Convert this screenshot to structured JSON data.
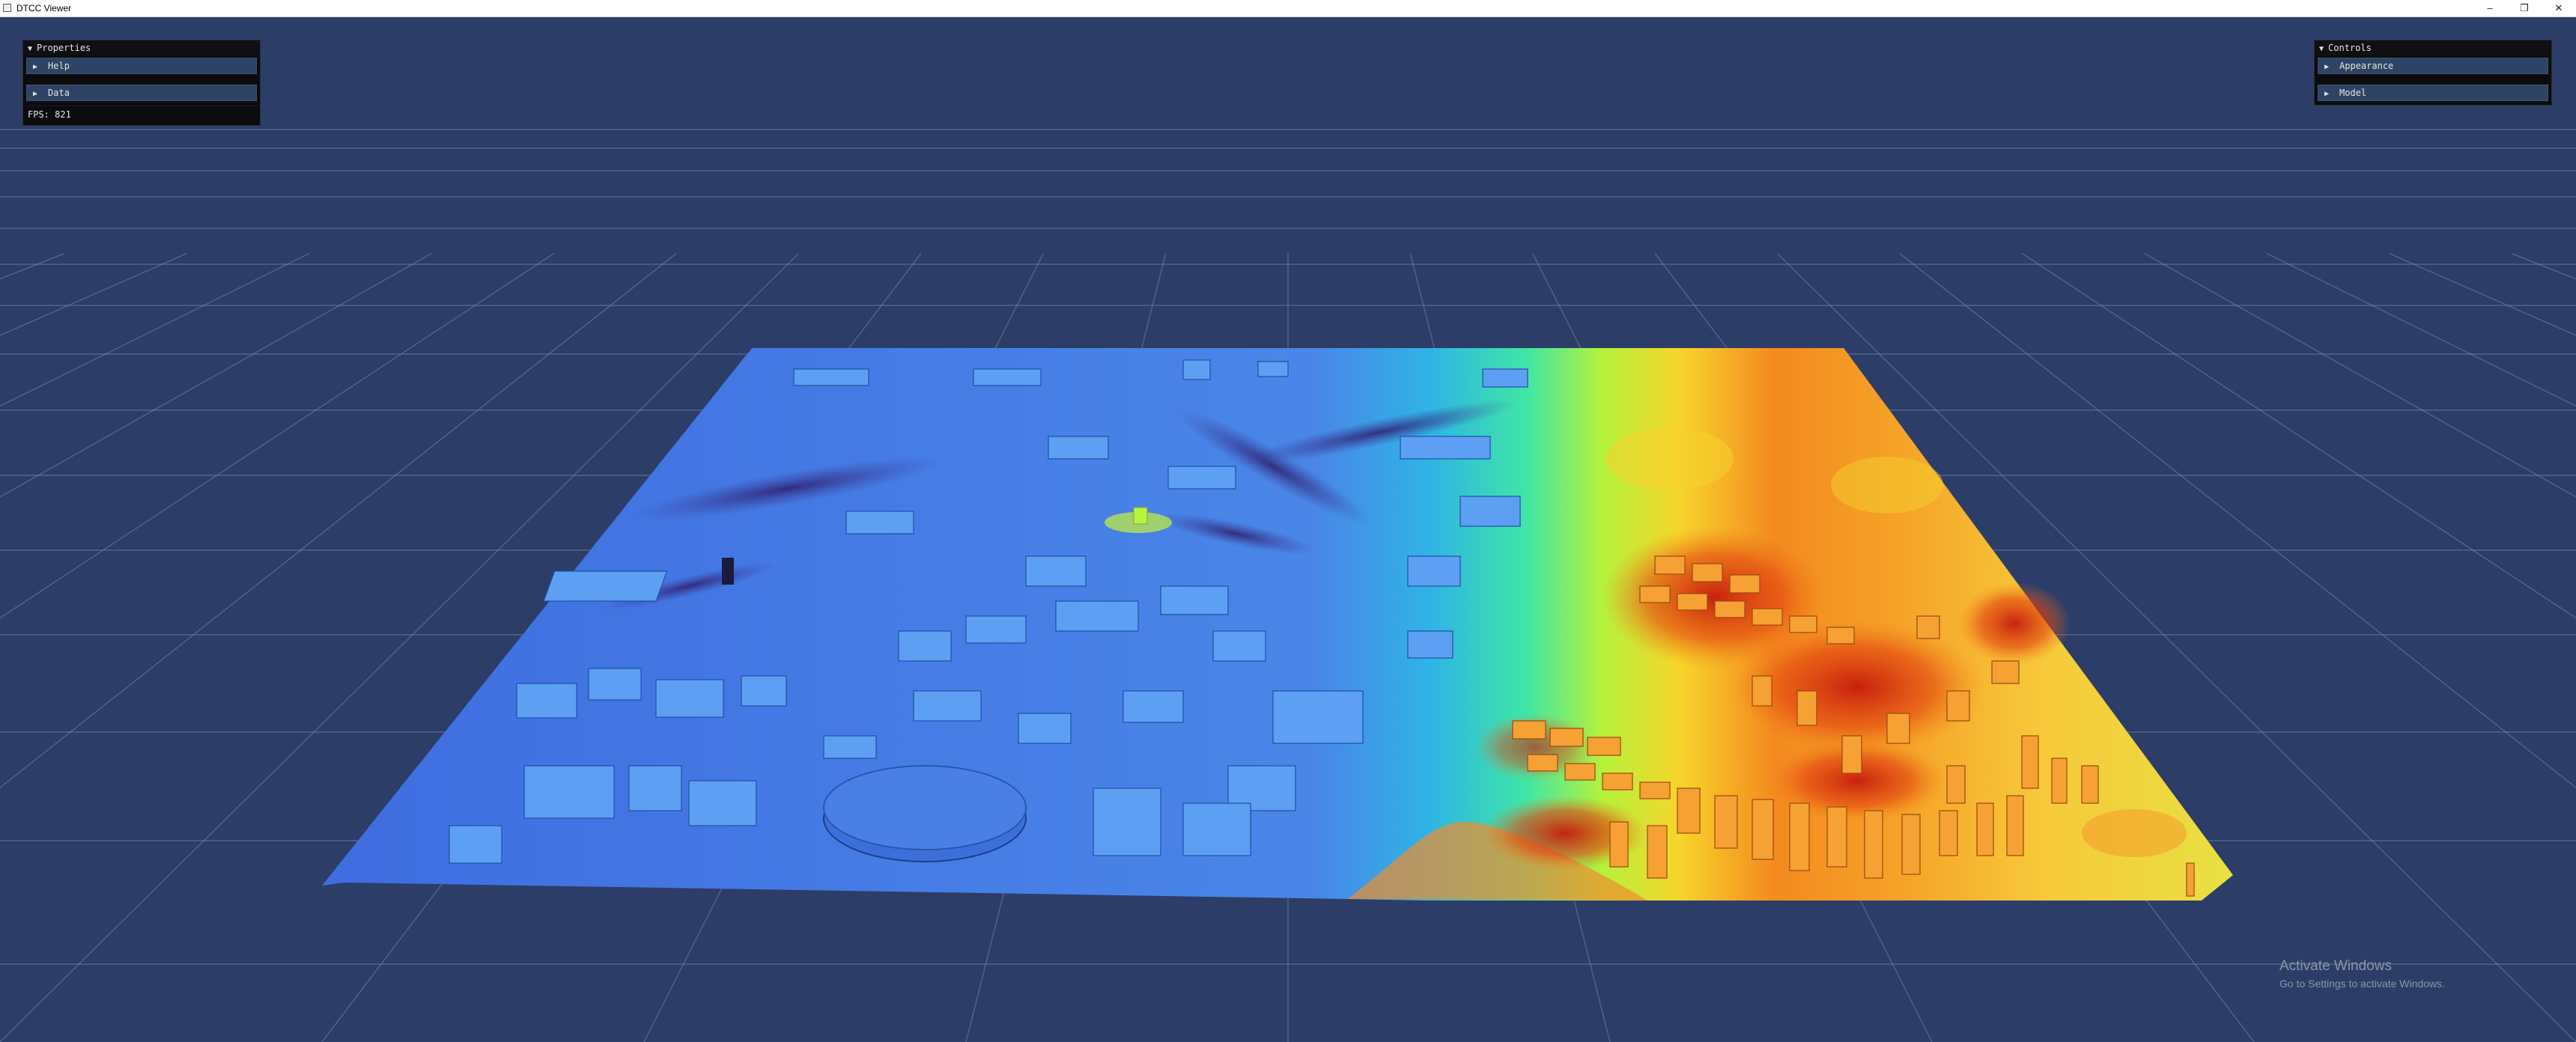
{
  "window": {
    "title": "DTCC Viewer",
    "controls": {
      "minimize": "–",
      "maximize": "❐",
      "close": "✕"
    }
  },
  "properties_panel": {
    "title": "Properties",
    "sections": [
      "Help",
      "Data"
    ],
    "fps": "FPS: 821"
  },
  "controls_panel": {
    "title": "Controls",
    "sections": [
      "Appearance",
      "Model"
    ]
  },
  "watermark": {
    "line1": "Activate Windows",
    "line2": "Go to Settings to activate Windows."
  },
  "scene": {
    "background_color": "#2c3e67",
    "grid_color": "#8190ab",
    "colormap": [
      "#2a1a6e",
      "#3d66e0",
      "#2bb5e8",
      "#3ee6a7",
      "#b5f23a",
      "#fbd82a",
      "#f77a1c",
      "#c81f0f"
    ]
  }
}
